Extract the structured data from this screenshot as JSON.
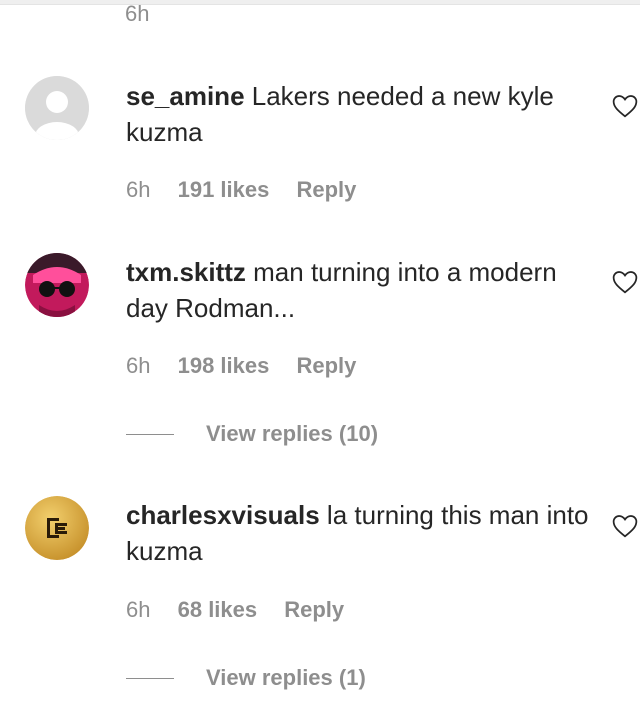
{
  "top": {
    "partial_time": "6h"
  },
  "comments": [
    {
      "username": "se_amine",
      "text": " Lakers needed a new kyle kuzma",
      "time": "6h",
      "likes": "191 likes",
      "reply": "Reply",
      "avatar": "default-avatar-icon"
    },
    {
      "username": "txm.skittz",
      "text": " man turning into a modern day Rodman...",
      "time": "6h",
      "likes": "198 likes",
      "reply": "Reply",
      "avatar": "profile-photo",
      "view_replies": "View replies (10)"
    },
    {
      "username": "charlesxvisuals",
      "text": " la turning this man into kuzma",
      "time": "6h",
      "likes": "68 likes",
      "reply": "Reply",
      "avatar": "ce-logo",
      "view_replies": "View replies (1)"
    }
  ],
  "colors": {
    "text": "#262626",
    "secondary": "#8e8e8e",
    "gold": "#d9a43a"
  }
}
